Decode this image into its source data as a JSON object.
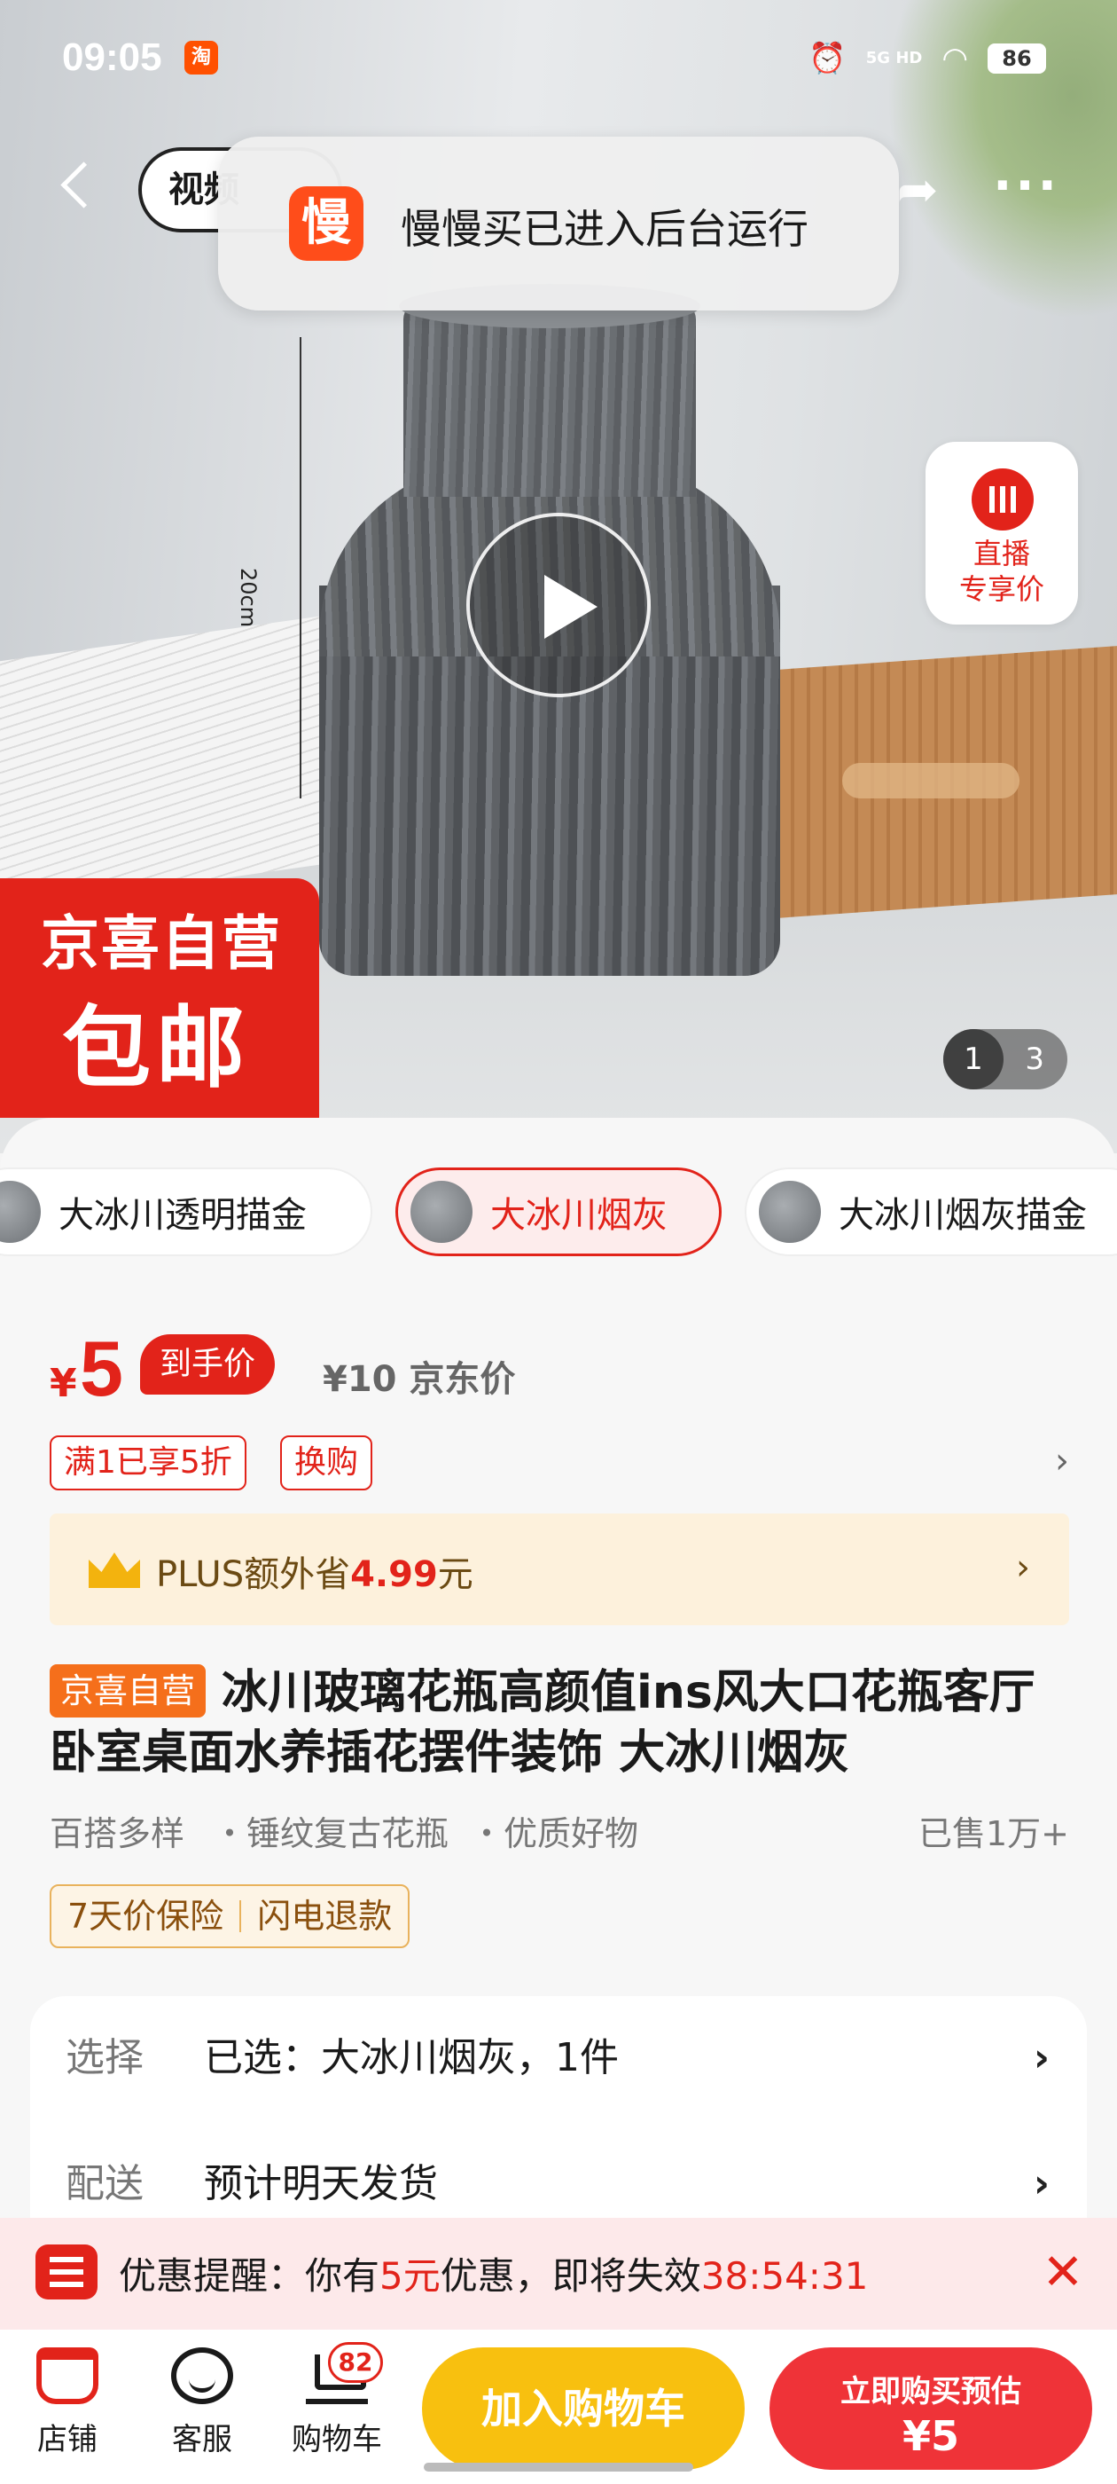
{
  "status_bar": {
    "time": "09:05",
    "app_icon_text": "淘",
    "network": "5G HD",
    "battery": "86"
  },
  "nav": {
    "video_tab": "视频"
  },
  "toast": {
    "icon_char": "慢",
    "text": "慢慢买已进入后台运行"
  },
  "media": {
    "dimension_label": "20cm",
    "badge_line1": "京喜自营",
    "badge_line2": "包邮",
    "image_index": "1",
    "image_total": "3"
  },
  "live": {
    "line1": "直播",
    "line2": "专享价"
  },
  "variants": [
    {
      "label": "大冰川透明描金",
      "active": false
    },
    {
      "label": "大冰川烟灰",
      "active": true
    },
    {
      "label": "大冰川烟灰描金",
      "active": false
    }
  ],
  "price": {
    "currency": "¥",
    "amount": "5",
    "tag": "到手价",
    "original": "¥10 京东价"
  },
  "promos": [
    "满1已享5折",
    "换购"
  ],
  "plus": {
    "prefix": "PLUS额外省",
    "amount": "4.99",
    "suffix": "元"
  },
  "product": {
    "shop_tag": "京喜自营",
    "title": "冰川玻璃花瓶高颜值ins风大口花瓶客厅卧室桌面水养插花摆件装饰 大冰川烟灰",
    "features": [
      "百搭多样",
      "・锤纹复古花瓶",
      "・优质好物"
    ],
    "sold": "已售1万+",
    "guarantees": [
      "7天价保险",
      "闪电退款"
    ]
  },
  "options": [
    {
      "label": "选择",
      "value": "已选：大冰川烟灰，1件"
    },
    {
      "label": "配送",
      "value": "预计明天发货"
    }
  ],
  "reminder": {
    "prefix": "优惠提醒：你有",
    "amount": "5元",
    "middle": "优惠，即将失效",
    "countdown": "38:54:31"
  },
  "bottom_bar": {
    "shop": "店铺",
    "service": "客服",
    "cart": "购物车",
    "cart_count": "82",
    "add_to_cart": "加入购物车",
    "buy_now_line1": "立即购买预估",
    "buy_now_line2": "¥5"
  },
  "colors": {
    "accent_red": "#e2231a",
    "cart_yellow": "#f8c00f",
    "buy_red": "#ef3338",
    "plus_bg": "#fdf1dc"
  }
}
